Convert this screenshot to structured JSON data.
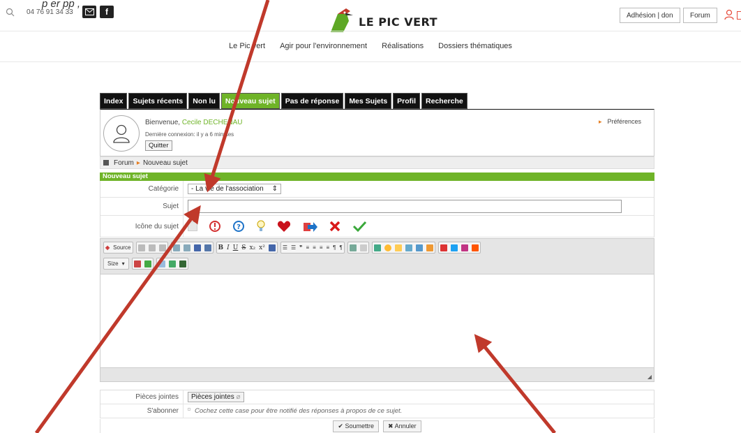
{
  "annotation_top_text": "p     er                                                       pp , ",
  "header": {
    "phone": "04 76 91 34 33",
    "logo_text": "LE PIC VERT",
    "adhesion_label": "Adhésion | don",
    "forum_label": "Forum",
    "icons": [
      "search-icon",
      "mail-icon",
      "facebook-icon",
      "user-icon"
    ]
  },
  "nav": {
    "items": [
      "Le Pic vert",
      "Agir pour l'environnement",
      "Réalisations",
      "Dossiers thématiques"
    ]
  },
  "tabs": [
    {
      "label": "Index"
    },
    {
      "label": "Sujets récents"
    },
    {
      "label": "Non lu"
    },
    {
      "label": "Nouveau sujet"
    },
    {
      "label": "Pas de réponse"
    },
    {
      "label": "Mes Sujets"
    },
    {
      "label": "Profil"
    },
    {
      "label": "Recherche"
    }
  ],
  "user_panel": {
    "welcome_prefix": "Bienvenue, ",
    "username": "Cecile DECHENAU",
    "last_connection": "Dernière connexion: il y a 6 minutes",
    "quit_label": "Quitter",
    "preferences_label": "Préférences"
  },
  "breadcrumb": {
    "root": "Forum",
    "current": "Nouveau sujet"
  },
  "section_title": "Nouveau sujet",
  "form": {
    "category_label": "Catégorie",
    "category_value": "- La vie de l'association",
    "subject_label": "Sujet",
    "subject_value": "",
    "topic_icon_label": "Icône du sujet",
    "topic_icons": [
      "blank-icon",
      "exclamation-icon",
      "question-icon",
      "lightbulb-icon",
      "heart-icon",
      "redirect-icon",
      "cross-icon",
      "checkmark-icon"
    ],
    "attachments_label": "Pièces jointes",
    "attachments_button": "Pièces jointes",
    "subscribe_label": "S'abonner",
    "subscribe_text": "Cochez cette case pour être notifié des réponses à propos de ce sujet.",
    "submit_label": "Soumettre",
    "cancel_label": "Annuler"
  },
  "editor": {
    "source_label": "Source",
    "size_label": "Size"
  },
  "colors": {
    "green": "#6fb428",
    "annotation_arrow": "#c0392b",
    "tab_bg": "#111111"
  }
}
